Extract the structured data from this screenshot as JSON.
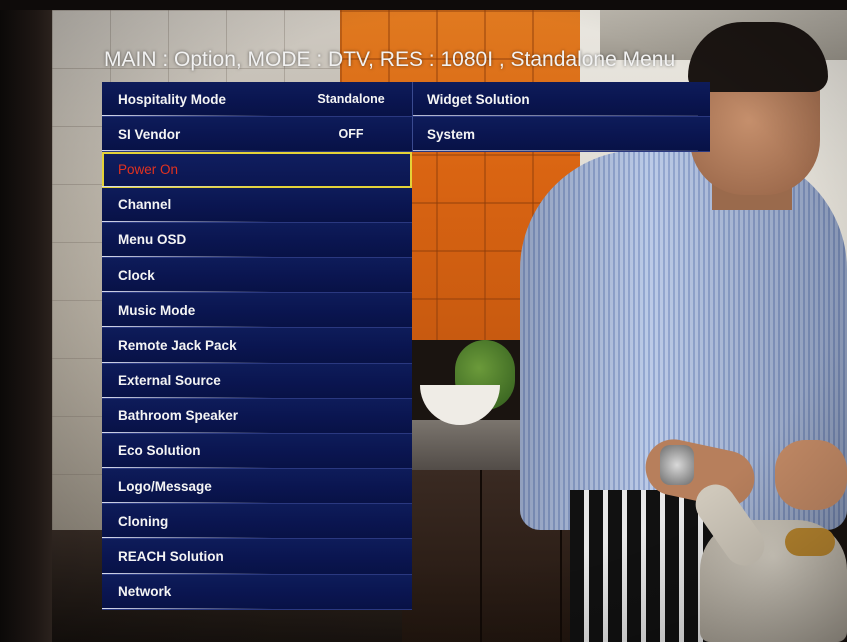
{
  "header": {
    "title": "MAIN : Option, MODE : DTV, RES : 1080I , Standalone Menu"
  },
  "menu_left": {
    "items": [
      {
        "label": "Hospitality Mode",
        "value": "Standalone"
      },
      {
        "label": "SI Vendor",
        "value": "OFF"
      },
      {
        "label": "Power On",
        "value": "",
        "selected": true
      },
      {
        "label": "Channel",
        "value": ""
      },
      {
        "label": "Menu OSD",
        "value": ""
      },
      {
        "label": "Clock",
        "value": ""
      },
      {
        "label": "Music Mode",
        "value": ""
      },
      {
        "label": "Remote Jack Pack",
        "value": ""
      },
      {
        "label": "External Source",
        "value": ""
      },
      {
        "label": "Bathroom Speaker",
        "value": ""
      },
      {
        "label": "Eco Solution",
        "value": ""
      },
      {
        "label": "Logo/Message",
        "value": ""
      },
      {
        "label": "Cloning",
        "value": ""
      },
      {
        "label": "REACH Solution",
        "value": ""
      },
      {
        "label": "Network",
        "value": ""
      }
    ]
  },
  "menu_right": {
    "items": [
      {
        "label": "Widget Solution"
      },
      {
        "label": "System"
      }
    ]
  },
  "colors": {
    "menu_bg": "#0a1550",
    "selected_border": "#e4d238",
    "selected_text": "#e2321f",
    "text": "#f4f4f4"
  }
}
